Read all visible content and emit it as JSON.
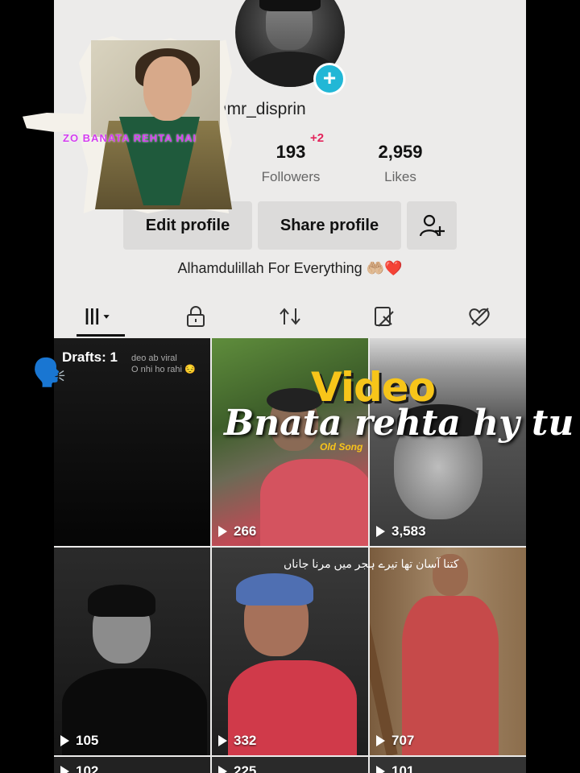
{
  "profile": {
    "username": "@mr_disprin",
    "followers_count": "193",
    "followers_label": "Followers",
    "followers_new": "+2",
    "likes_count": "2,959",
    "likes_label": "Likes",
    "edit_label": "Edit profile",
    "share_label": "Share profile",
    "bio": "Alhamdulillah For Everything 🤲🏼❤️"
  },
  "tabs": [
    {
      "name": "videos-grid-icon"
    },
    {
      "name": "lock-icon"
    },
    {
      "name": "repost-icon"
    },
    {
      "name": "saved-icon"
    },
    {
      "name": "liked-icon"
    }
  ],
  "grid": {
    "drafts_title": "Drafts: 1",
    "drafts_note_line1": "deo ab viral",
    "drafts_note_line2": "O nhi ho rahi 😔",
    "videos": [
      {
        "views": "266"
      },
      {
        "views": "3,583"
      },
      {
        "views": "105"
      },
      {
        "views": "332"
      },
      {
        "views": "707"
      },
      {
        "views": "102"
      },
      {
        "views": "225"
      },
      {
        "views": "101"
      }
    ],
    "old_song": "Old Song",
    "urdu_caption": "کتنا آسان تھا تیرے ہجر میں مرنا جاناں"
  },
  "overlay": {
    "sticker_caption": "ZO BANATA REHTA HAI",
    "title": "Video",
    "subtitle": "Bnata rehta hy tu",
    "speaking_emoji": "🗣️"
  },
  "colors": {
    "accent": "#22b7d6",
    "badge": "#e3245b",
    "overlay_yellow": "#f7c51a"
  }
}
